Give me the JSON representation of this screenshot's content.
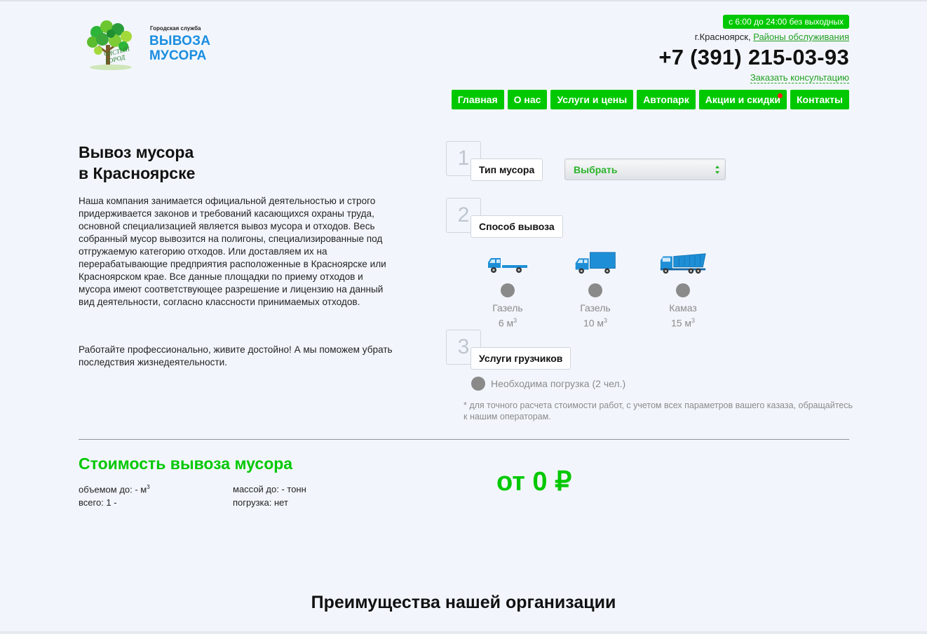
{
  "header": {
    "logo": {
      "small_text": "Городская служба",
      "line1": "ВЫВОЗА",
      "line2": "МУСОРА",
      "tagline1": "ЧИСТЫЙ",
      "tagline2": "ГОРОД"
    },
    "hours": "с 6:00 до 24:00 без выходных",
    "city": "г.Красноярск,",
    "districts_link": "Районы обслуживания",
    "phone": "+7 (391) 215-03-93",
    "consult_link": "Заказать консультацию",
    "nav": [
      {
        "label": "Главная"
      },
      {
        "label": "О нас"
      },
      {
        "label": "Услуги и цены"
      },
      {
        "label": "Автопарк"
      },
      {
        "label": "Акции и скидки"
      },
      {
        "label": "Контакты"
      }
    ]
  },
  "intro": {
    "title_line1": "Вывоз мусора",
    "title_line2": "в Красноярске",
    "paragraph1": "Наша компания занимается официальной деятельностью и строго придерживается законов и требований касающихся охраны труда, основной специализацией является вывоз мусора и отходов. Весь собранный мусор вывозится на полигоны, специализированные под отгружаемую категорию отходов. Или доставляем их на перерабатывающие предприятия расположенные в Красноярске или Красноярском крае. Все данные площадки по приему отходов и мусора имеют соответствующее разрешение и лицензию на данный вид деятельности, согласно классности принимаемых отходов.",
    "paragraph2": "Работайте профессионально, живите достойно! А мы поможем убрать последствия жизнедеятельности."
  },
  "calculator": {
    "step1": {
      "number": "1",
      "label": "Тип мусора",
      "select_value": "Выбрать"
    },
    "step2": {
      "number": "2",
      "label": "Способ вывоза"
    },
    "trucks": [
      {
        "name": "Газель",
        "volume": "6 м",
        "sup": "3",
        "icon": "flatbed-truck-icon"
      },
      {
        "name": "Газель",
        "volume": "10 м",
        "sup": "3",
        "icon": "box-truck-icon"
      },
      {
        "name": "Камаз",
        "volume": "15 м",
        "sup": "3",
        "icon": "dump-truck-icon"
      }
    ],
    "step3": {
      "number": "3",
      "label": "Услуги грузчиков"
    },
    "loaders_option": "Необходима погрузка (2 чел.)",
    "note": "* для точного расчета стоимости работ, с учетом всех параметров вашего казаза, обращайтесь к нашим операторам."
  },
  "cost": {
    "title": "Стоимость вывоза мусора",
    "volume": "объемом до: - м",
    "volume_sup": "3",
    "mass": "массой до: - тонн",
    "total": "всего: 1 -",
    "loading": "погрузка: нет",
    "price": "от 0 ₽"
  },
  "advantages": {
    "title": "Преимущества нашей организации"
  },
  "colors": {
    "accent": "#00c800",
    "link": "#22a022",
    "logo_blue": "#1a8de0",
    "truck_blue": "#1e8fd6",
    "muted": "#8a8a8a",
    "notification_dot": "#ff1a1a"
  }
}
